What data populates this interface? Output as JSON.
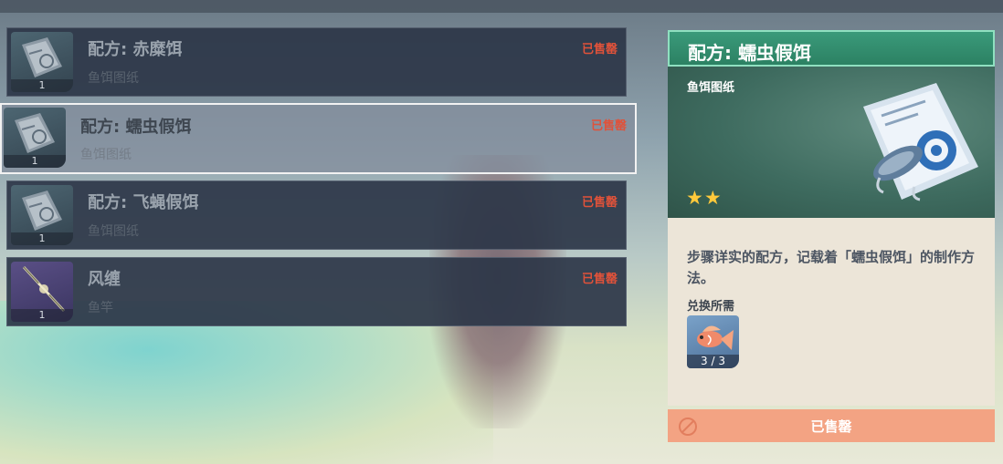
{
  "shop_list": {
    "items": [
      {
        "name": "配方: 赤糜饵",
        "type": "鱼饵图纸",
        "status": "已售罄",
        "count": "1",
        "icon": "blueprint-icon"
      },
      {
        "name": "配方: 蠕虫假饵",
        "type": "鱼饵图纸",
        "status": "已售罄",
        "count": "1",
        "icon": "blueprint-icon",
        "selected": true
      },
      {
        "name": "配方: 飞蝇假饵",
        "type": "鱼饵图纸",
        "status": "已售罄",
        "count": "1",
        "icon": "blueprint-icon"
      },
      {
        "name": "风缠",
        "type": "鱼竿",
        "status": "已售罄",
        "count": "1",
        "icon": "fishing-rod-icon"
      }
    ]
  },
  "detail": {
    "title": "配方: 蠕虫假饵",
    "type": "鱼饵图纸",
    "rarity": "★★",
    "description": "步骤详实的配方，记载着「蠕虫假饵」的制作方法。",
    "requirement_label": "兑换所需",
    "requirement": {
      "icon": "fish-icon",
      "count": "3 / 3"
    },
    "button_label": "已售罄"
  },
  "colors": {
    "sold_out": "#e0523a",
    "title_bar": "#2c8163",
    "button": "#f3a383",
    "star": "#ffc93b"
  }
}
